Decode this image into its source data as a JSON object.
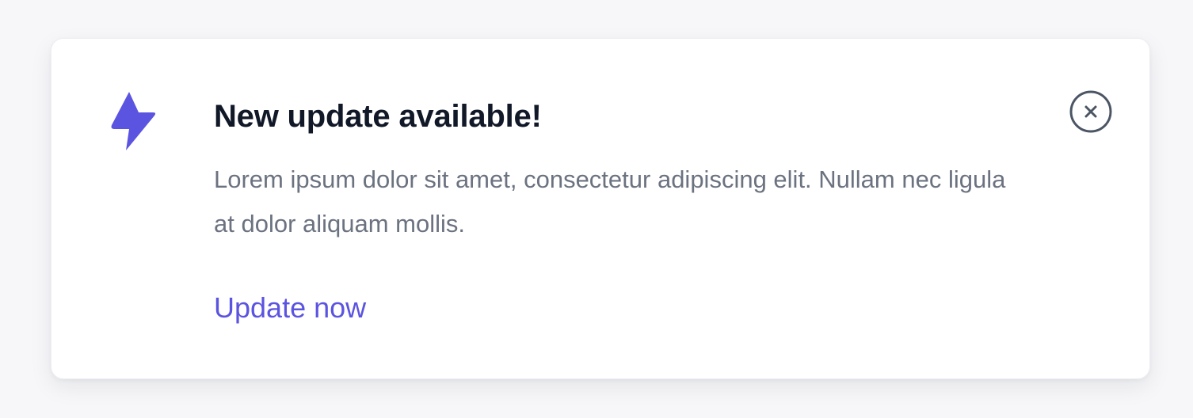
{
  "notification": {
    "title": "New update available!",
    "message": "Lorem ipsum dolor sit amet, consectetur adipiscing elit. Nullam nec ligula at dolor aliquam mollis.",
    "action_label": "Update now",
    "icon": "lightning-bolt-icon",
    "close_icon": "close-circle-icon"
  },
  "colors": {
    "accent": "#5b54e0",
    "title": "#111827",
    "message": "#6b7280",
    "close_icon": "#4b5563"
  }
}
